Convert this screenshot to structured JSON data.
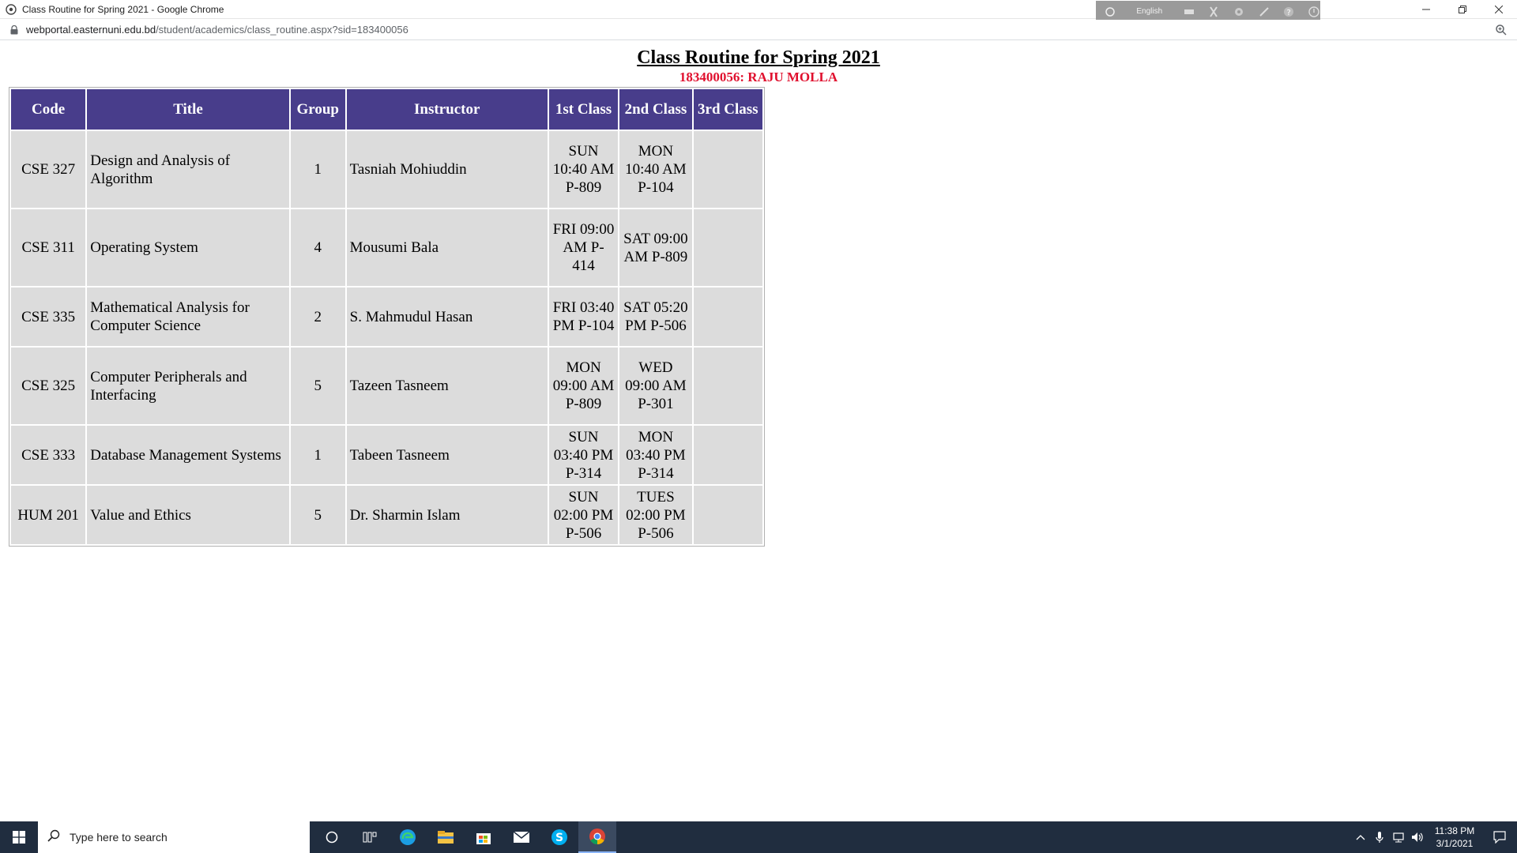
{
  "window": {
    "title": "Class Routine for Spring 2021 - Google Chrome",
    "ime_language": "English"
  },
  "address_bar": {
    "url_host": "webportal.easternuni.edu.bd",
    "url_path": "/student/academics/class_routine.aspx?sid=183400056"
  },
  "page": {
    "title": "Class Routine for Spring 2021",
    "student": "183400056: RAJU MOLLA"
  },
  "table": {
    "headers": [
      "Code",
      "Title",
      "Group",
      "Instructor",
      "1st Class",
      "2nd Class",
      "3rd Class"
    ],
    "rows": [
      {
        "code": "CSE 327",
        "title": "Design and Analysis of Algorithm",
        "group": "1",
        "instructor": "Tasniah Mohiuddin",
        "class1": "SUN 10:40 AM P-809",
        "class2": "MON 10:40 AM P-104",
        "class3": ""
      },
      {
        "code": "CSE 311",
        "title": "Operating System",
        "group": "4",
        "instructor": "Mousumi Bala",
        "class1": "FRI 09:00 AM P-414",
        "class2": "SAT 09:00 AM P-809",
        "class3": ""
      },
      {
        "code": "CSE 335",
        "title": "Mathematical Analysis for Computer Science",
        "group": "2",
        "instructor": "S. Mahmudul Hasan",
        "class1": "FRI 03:40 PM P-104",
        "class2": "SAT 05:20 PM P-506",
        "class3": ""
      },
      {
        "code": "CSE 325",
        "title": "Computer Peripherals and Interfacing",
        "group": "5",
        "instructor": "Tazeen Tasneem",
        "class1": "MON 09:00 AM P-809",
        "class2": "WED 09:00 AM P-301",
        "class3": ""
      },
      {
        "code": "CSE 333",
        "title": "Database Management Systems",
        "group": "1",
        "instructor": "Tabeen Tasneem",
        "class1": "SUN 03:40 PM P-314",
        "class2": "MON 03:40 PM P-314",
        "class3": ""
      },
      {
        "code": "HUM 201",
        "title": "Value and Ethics",
        "group": "5",
        "instructor": "Dr. Sharmin Islam",
        "class1": "SUN 02:00 PM P-506",
        "class2": "TUES 02:00 PM P-506",
        "class3": ""
      }
    ]
  },
  "taskbar": {
    "search_placeholder": "Type here to search",
    "time": "11:38 PM",
    "date": "3/1/2021",
    "apps": [
      "task-view",
      "timeline",
      "edge",
      "file-explorer",
      "store",
      "mail",
      "skype",
      "chrome"
    ]
  },
  "colors": {
    "header_bg": "#483d8b",
    "cell_bg": "#dcdcdc",
    "student_text": "#e0102e",
    "taskbar_bg": "#202d3f"
  }
}
